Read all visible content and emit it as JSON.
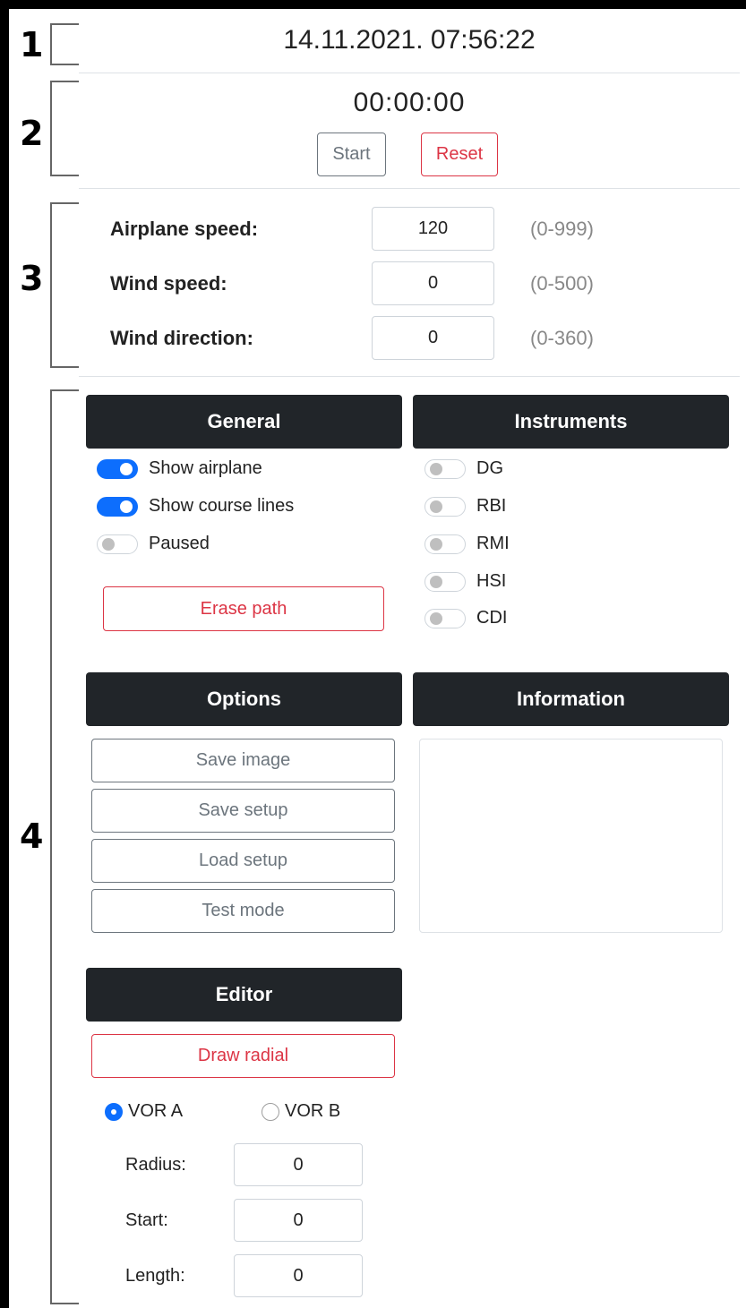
{
  "sections": [
    "1",
    "2",
    "3",
    "4"
  ],
  "datetime": "14.11.2021. 07:56:22",
  "stopwatch": {
    "time": "00:00:00",
    "start_label": "Start",
    "reset_label": "Reset"
  },
  "params": [
    {
      "label": "Airplane speed:",
      "value": "120",
      "range": "(0-999)"
    },
    {
      "label": "Wind speed:",
      "value": "0",
      "range": "(0-500)"
    },
    {
      "label": "Wind direction:",
      "value": "0",
      "range": "(0-360)"
    }
  ],
  "general": {
    "title": "General",
    "toggles": [
      {
        "label": "Show airplane",
        "on": true
      },
      {
        "label": "Show course lines",
        "on": true
      },
      {
        "label": "Paused",
        "on": false
      }
    ],
    "erase_label": "Erase path"
  },
  "instruments": {
    "title": "Instruments",
    "toggles": [
      {
        "label": "DG",
        "on": false
      },
      {
        "label": "RBI",
        "on": false
      },
      {
        "label": "RMI",
        "on": false
      },
      {
        "label": "HSI",
        "on": false
      },
      {
        "label": "CDI",
        "on": false
      }
    ]
  },
  "options": {
    "title": "Options",
    "buttons": [
      "Save image",
      "Save setup",
      "Load setup",
      "Test mode"
    ]
  },
  "information": {
    "title": "Information"
  },
  "editor": {
    "title": "Editor",
    "draw_label": "Draw radial",
    "radios": [
      {
        "label": "VOR A",
        "checked": true
      },
      {
        "label": "VOR B",
        "checked": false
      }
    ],
    "fields": [
      {
        "label": "Radius:",
        "value": "0"
      },
      {
        "label": "Start:",
        "value": "0"
      },
      {
        "label": "Length:",
        "value": "0"
      }
    ]
  },
  "colors": {
    "accent": "#0d6efd",
    "danger": "#dc3545",
    "header_bg": "#212529",
    "secondary": "#6c757d"
  }
}
